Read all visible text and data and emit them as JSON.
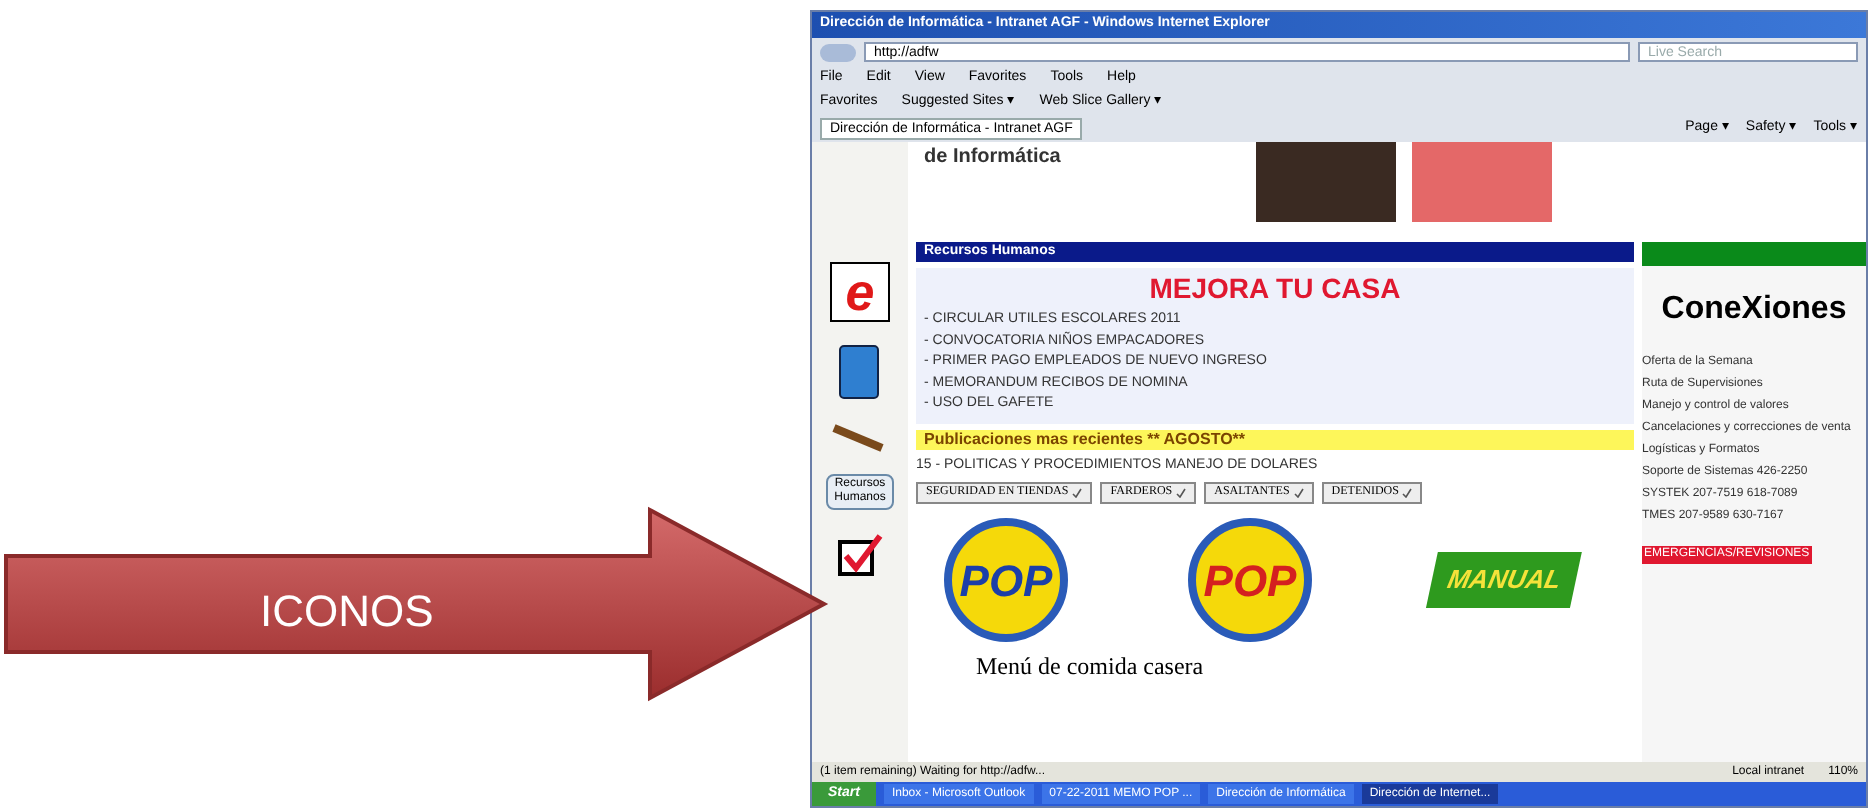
{
  "slide": {
    "arrow_label": "ICONOS"
  },
  "browser": {
    "title": "Dirección de Informática - Intranet AGF - Windows Internet Explorer",
    "address": "http://adfw",
    "search_placeholder": "Live Search",
    "menu": [
      "File",
      "Edit",
      "View",
      "Favorites",
      "Tools",
      "Help"
    ],
    "favorites": [
      "Favorites",
      "Suggested Sites ▾",
      "Web Slice Gallery ▾"
    ],
    "tab": {
      "label": "Dirección de Informática - Intranet AGF",
      "selected": true
    },
    "commands": [
      "Page ▾",
      "Safety ▾",
      "Tools ▾"
    ]
  },
  "page": {
    "banner_title": "de Informática",
    "sidebar": {
      "e_logo": "e",
      "hr_button": "Recursos Humanos"
    },
    "section": {
      "title": "Recursos Humanos",
      "headline": "MEJORA TU CASA",
      "items": [
        "- CIRCULAR UTILES  ESCOLARES 2011",
        "- CONVOCATORIA NIÑOS EMPACADORES",
        "- PRIMER PAGO EMPLEADOS DE NUEVO INGRESO",
        "- MEMORANDUM RECIBOS DE NOMINA",
        "- USO DEL GAFETE"
      ]
    },
    "publications": {
      "title": "Publicaciones mas recientes ** AGOSTO**",
      "line": "15 - POLITICAS Y PROCEDIMIENTOS MANEJO DE DOLARES",
      "buttons": [
        "SEGURIDAD EN TIENDAS",
        "FARDEROS",
        "ASALTANTES",
        "DETENIDOS"
      ]
    },
    "logos": [
      {
        "kind": "pop",
        "text": "POP",
        "color": "#1c3fa8"
      },
      {
        "kind": "pop",
        "text": "POP",
        "color": "#d42020"
      },
      {
        "kind": "manual",
        "text": "MANUAL",
        "color": "#2e9a1e"
      }
    ],
    "menu_title": "Menú de comida casera",
    "right_panel": {
      "logo": "ConeXiones",
      "links": [
        "Oferta de la Semana",
        "Ruta de Supervisiones",
        "Manejo y control de valores",
        "Cancelaciones y correcciones de venta",
        "Logísticas y Formatos",
        "Soporte de Sistemas 426-2250",
        "SYSTEK 207-7519 618-7089",
        "TMES   207-9589 630-7167"
      ],
      "alert": "EMERGENCIAS/REVISIONES"
    }
  },
  "status_bar": {
    "text": "(1 item remaining) Waiting for http://adfw...",
    "zone": "Local intranet",
    "zoom": "110%"
  },
  "taskbar": {
    "start": "Start",
    "tasks": [
      {
        "label": "Inbox - Microsoft Outlook",
        "selected": false
      },
      {
        "label": "07-22-2011 MEMO POP ...",
        "selected": false
      },
      {
        "label": "Dirección de Informática",
        "selected": false
      },
      {
        "label": "Dirección de Internet...",
        "selected": true
      }
    ]
  }
}
